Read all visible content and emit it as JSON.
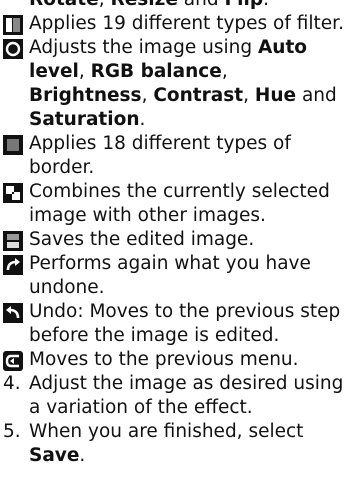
{
  "intro_tail": {
    "b1": "Rotate",
    "t1": ", ",
    "b2": "Resize",
    "t2": " and ",
    "b3": "Flip",
    "t3": "."
  },
  "items": [
    {
      "icon": "filter-icon",
      "text": "Applies 19 different types of filter."
    },
    {
      "icon": "adjust-icon",
      "t0": "Adjusts the image using ",
      "b1": "Auto level",
      "t1": ", ",
      "b2": "RGB balance",
      "t2": ", ",
      "b3": "Brightness",
      "t3": ", ",
      "b4": "Contrast",
      "t4": ", ",
      "b5": "Hue",
      "t5": " and ",
      "b6": "Saturation",
      "t6": "."
    },
    {
      "icon": "border-icon",
      "text": "Applies 18 different types of border."
    },
    {
      "icon": "combine-icon",
      "text": "Combines the currently selected image with other images."
    },
    {
      "icon": "save-icon",
      "text": "Saves the edited image."
    },
    {
      "icon": "redo-icon",
      "text": "Performs again what you have undone."
    },
    {
      "icon": "undo-icon",
      "text": "Undo: Moves to the previous step before the image is edited."
    },
    {
      "icon": "back-icon",
      "text": "Moves to the previous menu."
    }
  ],
  "steps": [
    {
      "num": "4.",
      "text": "Adjust the image as desired using a variation of the effect."
    },
    {
      "num": "5.",
      "t0": "When you are finished, select ",
      "b1": "Save",
      "t1": "."
    }
  ]
}
